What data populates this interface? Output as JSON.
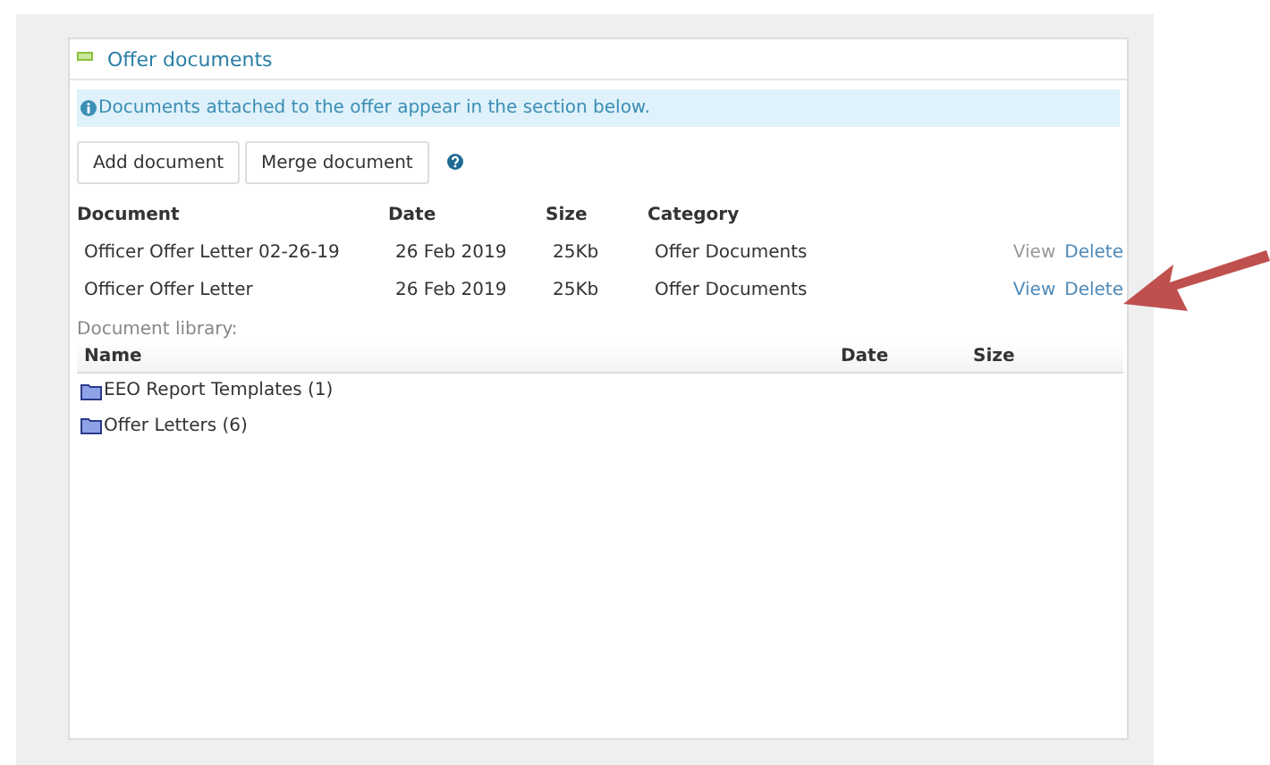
{
  "panel": {
    "title": "Offer documents",
    "expanded": true,
    "info": "Documents attached to the offer appear in the section below.",
    "buttons": [
      "Add document",
      "Merge document"
    ],
    "documents": {
      "columns": [
        "Document",
        "Date",
        "Size",
        "Category"
      ],
      "rows": [
        {
          "document": "Officer Offer Letter 02-26-19",
          "date": "26 Feb 2019",
          "size": "25Kb",
          "category": "Offer Documents",
          "view": {
            "label": "View",
            "visited": true
          },
          "delete": "Delete"
        },
        {
          "document": "Officer Offer Letter",
          "date": "26 Feb 2019",
          "size": "25Kb",
          "category": "Offer Documents",
          "view": {
            "label": "View",
            "visited": false
          },
          "delete": "Delete"
        }
      ]
    },
    "library": {
      "label": "Document library:",
      "columns": [
        "Name",
        "Date",
        "Size"
      ],
      "folders": [
        {
          "name": "EEO Report Templates (1)"
        },
        {
          "name": "Offer Letters (6)"
        }
      ]
    }
  },
  "annotation": {
    "kind": "arrow"
  }
}
